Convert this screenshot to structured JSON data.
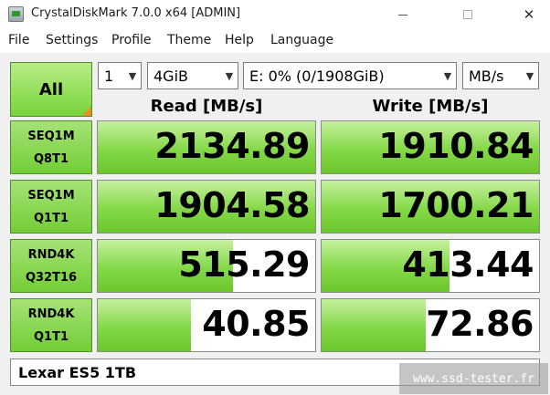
{
  "window": {
    "title": "CrystalDiskMark 7.0.0 x64 [ADMIN]",
    "minimize_glyph": "",
    "close_glyph": "✕"
  },
  "menu": {
    "items": [
      "File",
      "Settings",
      "Profile",
      "Theme",
      "Help",
      "Language"
    ]
  },
  "controls": {
    "all_label": "All",
    "count": "1",
    "size": "4GiB",
    "drive": "E: 0% (0/1908GiB)",
    "unit": "MB/s"
  },
  "headers": {
    "read": "Read [MB/s]",
    "write": "Write [MB/s]"
  },
  "tests": [
    {
      "line1": "SEQ1M",
      "line2": "Q8T1",
      "read": "2134.89",
      "write": "1910.84",
      "read_fill": 1.0,
      "write_fill": 1.0
    },
    {
      "line1": "SEQ1M",
      "line2": "Q1T1",
      "read": "1904.58",
      "write": "1700.21",
      "read_fill": 1.0,
      "write_fill": 1.0
    },
    {
      "line1": "RND4K",
      "line2": "Q32T16",
      "read": "515.29",
      "write": "413.44",
      "read_fill": 0.62,
      "write_fill": 0.59
    },
    {
      "line1": "RND4K",
      "line2": "Q1T1",
      "read": "40.85",
      "write": "72.86",
      "read_fill": 0.43,
      "write_fill": 0.48
    }
  ],
  "comment": "Lexar ES5 1TB",
  "watermark": "www.ssd-tester.fr",
  "colors": {
    "accent_green": "#78d43a",
    "corner_orange": "#f08a1c"
  }
}
